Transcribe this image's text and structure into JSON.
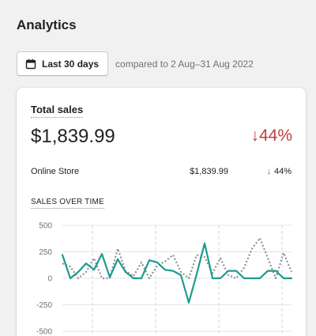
{
  "page": {
    "title": "Analytics"
  },
  "toolbar": {
    "date_range_label": "Last 30 days",
    "compare_text": "compared to 2 Aug–31 Aug 2022",
    "calendar_icon": "calendar-icon"
  },
  "total_sales_card": {
    "title": "Total sales",
    "value": "$1,839.99",
    "change": "↓44%",
    "change_color": "#bf3e3e",
    "rows": [
      {
        "label": "Online Store",
        "value": "$1,839.99",
        "change_arrow": "↓",
        "change": "44%"
      }
    ],
    "subheading": "SALES OVER TIME"
  },
  "colors": {
    "current_series": "#1f9a8f",
    "previous_series": "#8c9196",
    "negative": "#bf3e3e"
  },
  "chart_data": {
    "type": "line",
    "y_ticks": [
      "500",
      "250",
      "0",
      "-250",
      "-500"
    ],
    "ylim": [
      -500,
      500
    ],
    "grid": true,
    "series": [
      {
        "values": [
          220,
          0,
          60,
          140,
          80,
          230,
          10,
          180,
          60,
          0,
          0,
          170,
          150,
          80,
          70,
          30,
          -230,
          40,
          330,
          0,
          0,
          70,
          70,
          0,
          0,
          0,
          70,
          70,
          0,
          0
        ]
      },
      {
        "values": [
          140,
          110,
          0,
          60,
          190,
          0,
          0,
          280,
          70,
          20,
          150,
          0,
          120,
          160,
          220,
          60,
          0,
          220,
          200,
          50,
          190,
          30,
          0,
          100,
          280,
          380,
          190,
          0,
          240,
          60
        ]
      }
    ]
  }
}
